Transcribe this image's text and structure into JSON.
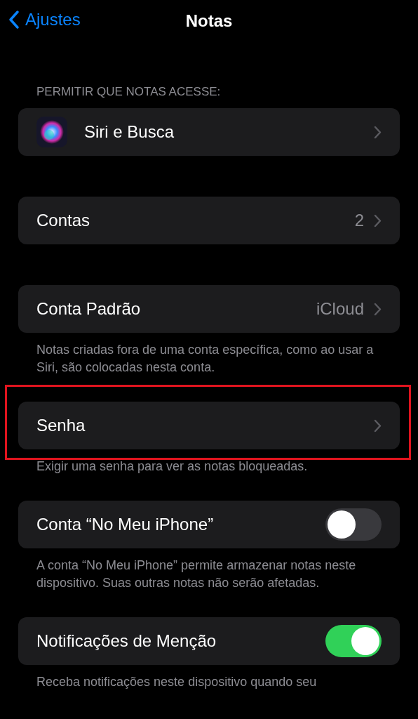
{
  "nav": {
    "back_label": "Ajustes",
    "title": "Notas"
  },
  "sections": [
    {
      "header": "PERMITIR QUE NOTAS ACESSE:",
      "rows": [
        {
          "kind": "icon-link",
          "label": "Siri e Busca"
        }
      ]
    },
    {
      "rows": [
        {
          "kind": "link",
          "label": "Contas",
          "value": "2"
        }
      ]
    },
    {
      "rows": [
        {
          "kind": "link",
          "label": "Conta Padrão",
          "value": "iCloud"
        }
      ],
      "footer": "Notas criadas fora de uma conta específica, como ao usar a Siri, são colocadas nesta conta."
    },
    {
      "highlighted": true,
      "rows": [
        {
          "kind": "link",
          "label": "Senha"
        }
      ],
      "footer": "Exigir uma senha para ver as notas bloqueadas."
    },
    {
      "rows": [
        {
          "kind": "toggle",
          "label": "Conta “No Meu iPhone”",
          "on": false
        }
      ],
      "footer": "A conta “No Meu iPhone” permite armazenar notas neste dispositivo. Suas outras notas não serão afetadas."
    },
    {
      "rows": [
        {
          "kind": "toggle",
          "label": "Notificações de Menção",
          "on": true
        }
      ],
      "footer": "Receba notificações neste dispositivo quando seu"
    }
  ]
}
